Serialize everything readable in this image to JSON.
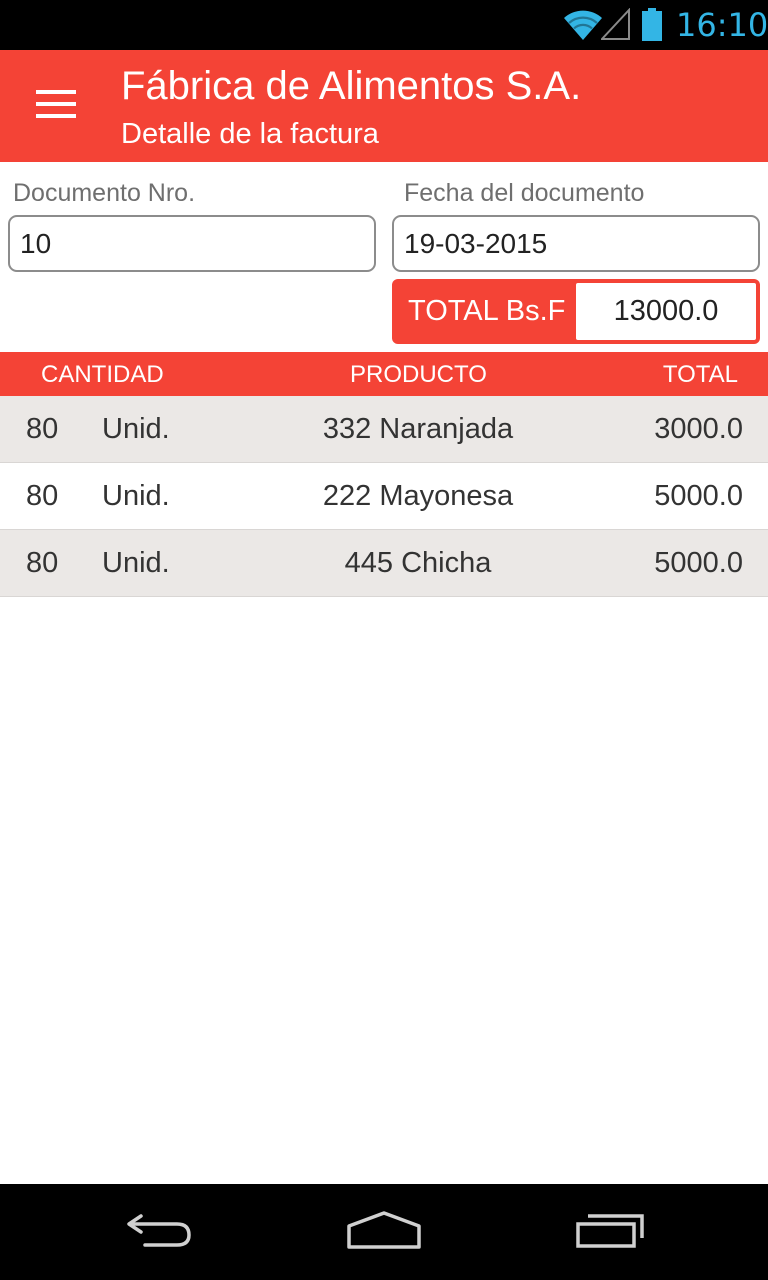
{
  "status_bar": {
    "time": "16:10",
    "icons": [
      "wifi-icon",
      "cell-signal-icon",
      "battery-icon"
    ],
    "accent_color": "#33b5e5"
  },
  "app_bar": {
    "title": "Fábrica de Alimentos S.A.",
    "subtitle": "Detalle de la factura",
    "menu_icon": "hamburger-menu-icon",
    "color": "#f44336"
  },
  "form": {
    "document_number": {
      "label": "Documento Nro.",
      "value": "10"
    },
    "document_date": {
      "label": "Fecha del documento",
      "value": "19-03-2015"
    },
    "total": {
      "label": "TOTAL Bs.F",
      "value": "13000.0"
    }
  },
  "table": {
    "headers": {
      "quantity": "CANTIDAD",
      "product": "PRODUCTO",
      "total": "TOTAL"
    },
    "rows": [
      {
        "quantity": "80",
        "unit": "Unid.",
        "product": "332 Naranjada",
        "total": "3000.0"
      },
      {
        "quantity": "80",
        "unit": "Unid.",
        "product": "222 Mayonesa",
        "total": "5000.0"
      },
      {
        "quantity": "80",
        "unit": "Unid.",
        "product": "445 Chicha",
        "total": "5000.0"
      }
    ],
    "alt_row_color": "#ebe8e6"
  },
  "nav_bar": {
    "icons": [
      "back-icon",
      "home-icon",
      "recent-apps-icon"
    ]
  }
}
